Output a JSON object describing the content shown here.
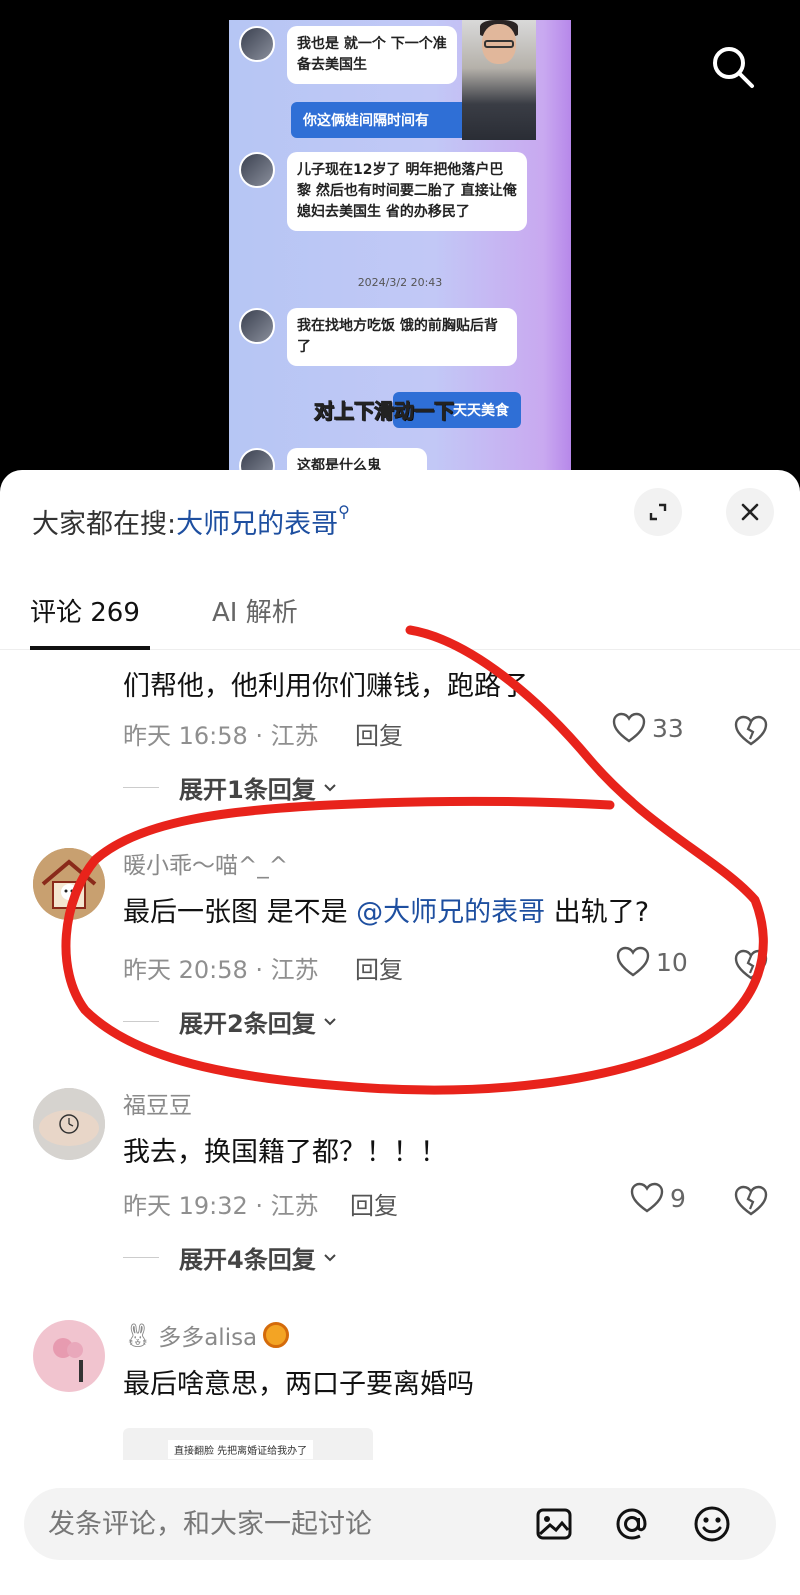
{
  "video": {
    "chat": [
      {
        "from": "received",
        "text": "我也是 就一个 下一个准备去美国生"
      },
      {
        "from": "sent",
        "text": "你这俩娃间隔时间有"
      },
      {
        "from": "received",
        "text": "儿子现在12岁了 明年把他落户巴黎 然后也有时间要二胎了 直接让俺媳妇去美国生 省的办移民了"
      },
      {
        "from": "received",
        "text": "我在找地方吃饭 饿的前胸贴后背了"
      },
      {
        "from": "sent",
        "text": "天天美食"
      },
      {
        "from": "received",
        "text": "这都是什么鬼"
      }
    ],
    "chat_time": "2024/3/2 20:43",
    "caption": "对上下滑动一下"
  },
  "sheet": {
    "search_prefix": "大家都在搜:",
    "search_keyword": "大师兄的表哥",
    "tabs": [
      {
        "label": "评论 269",
        "active": true
      },
      {
        "label": "AI 解析",
        "active": false
      }
    ]
  },
  "comments": [
    {
      "user": "",
      "text": "们帮他，他利用你们赚钱，跑路了",
      "meta": "昨天 16:58 · 江苏",
      "reply_label": "回复",
      "likes": "33",
      "expand": "展开1条回复"
    },
    {
      "user": "暖小乖～喵^_^",
      "text_before": "最后一张图 是不是 ",
      "mention": "@大师兄的表哥",
      "text_after": " 出轨了?",
      "meta": "昨天 20:58 · 江苏",
      "reply_label": "回复",
      "likes": "10",
      "expand": "展开2条回复"
    },
    {
      "user": "福豆豆",
      "text": "我去，换国籍了都？！！！",
      "meta": "昨天 19:32 · 江苏",
      "reply_label": "回复",
      "likes": "9",
      "expand": "展开4条回复"
    },
    {
      "user": "多多alisa",
      "text": "最后啥意思，两口子要离婚吗",
      "image_text": "直接翻脸 先把离婚证给我办了"
    }
  ],
  "input": {
    "placeholder": "发条评论，和大家一起讨论"
  },
  "colors": {
    "mention": "#1e4fa0",
    "annotation": "#e8231b"
  }
}
